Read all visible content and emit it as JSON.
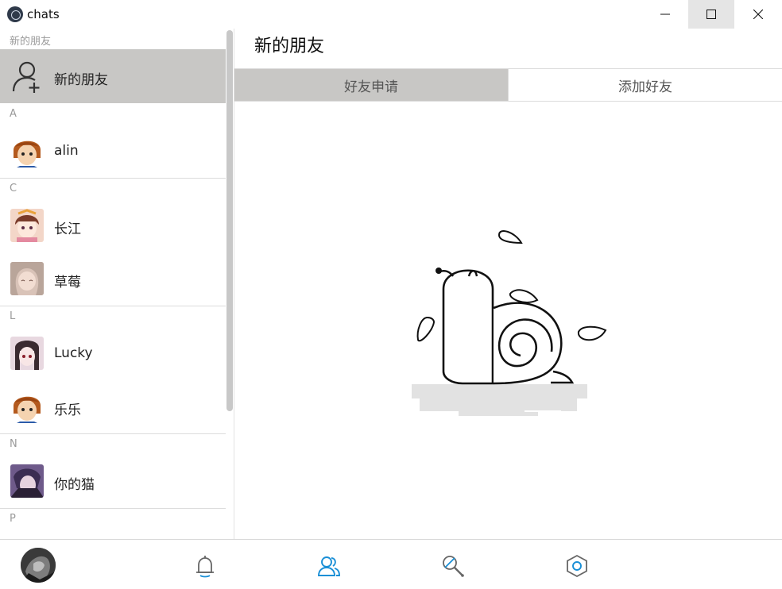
{
  "window": {
    "title": "chats"
  },
  "sidebar": {
    "sections": [
      {
        "label": "新的朋友"
      },
      {
        "label": "A"
      },
      {
        "label": "C"
      },
      {
        "label": "L"
      },
      {
        "label": "N"
      },
      {
        "label": "P"
      }
    ],
    "contacts": [
      {
        "name": "新的朋友",
        "icon": "add-user-icon",
        "selected": true
      },
      {
        "name": "alin"
      },
      {
        "name": "长江"
      },
      {
        "name": "草莓"
      },
      {
        "name": "Lucky"
      },
      {
        "name": "乐乐"
      },
      {
        "name": "你的猫"
      }
    ]
  },
  "main": {
    "title": "新的朋友",
    "tabs": [
      {
        "label": "好友申请",
        "active": true
      },
      {
        "label": "添加好友",
        "active": false
      }
    ],
    "empty_state_icon": "snail-illustration"
  },
  "bottom_nav": {
    "items": [
      {
        "icon": "bell-icon",
        "active": false
      },
      {
        "icon": "contacts-icon",
        "active": true
      },
      {
        "icon": "search-tool-icon",
        "active": false
      },
      {
        "icon": "settings-hexagon-icon",
        "active": false
      }
    ]
  },
  "colors": {
    "selected_bg": "#c8c7c5",
    "accent": "#1a8fd6",
    "icon_gray": "#666666"
  }
}
